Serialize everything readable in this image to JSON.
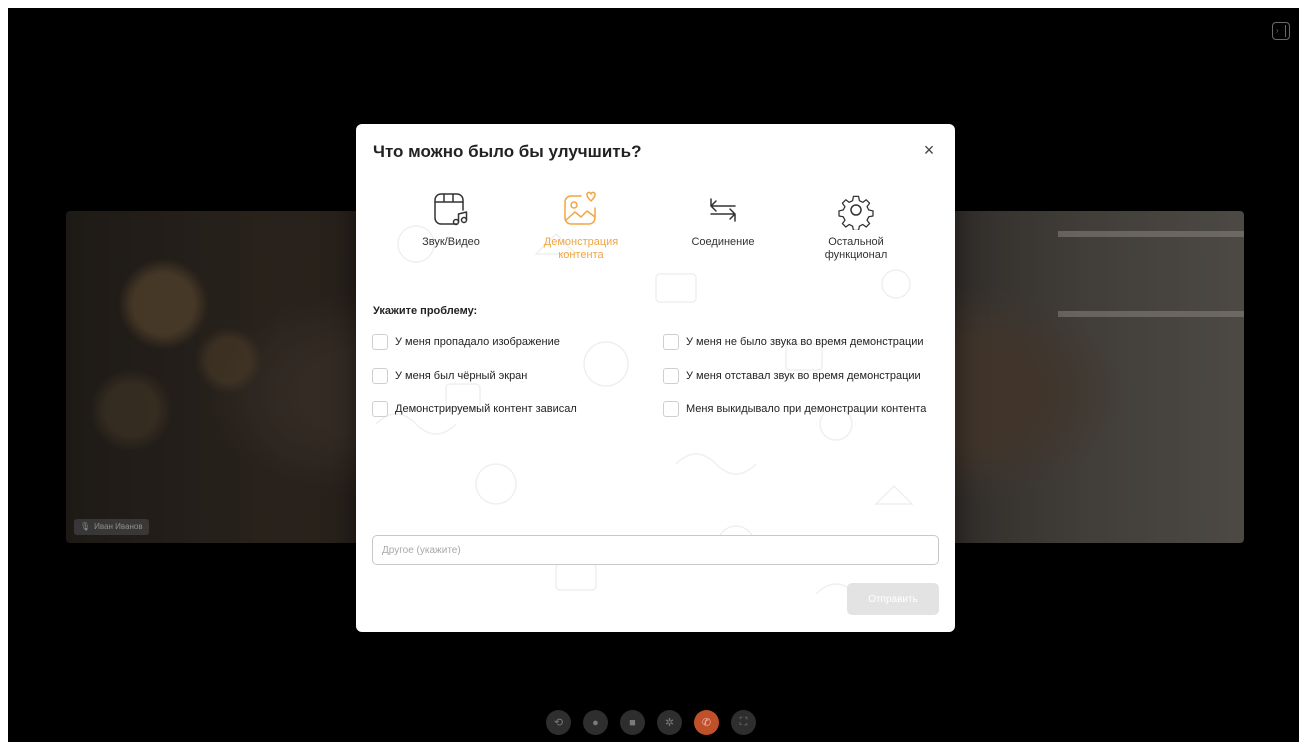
{
  "modal": {
    "title": "Что можно было бы улучшить?",
    "close_symbol": "×",
    "categories": [
      {
        "label": "Звук/Видео",
        "icon": "audio-video-icon",
        "active": false
      },
      {
        "label": "Демонстрация контента",
        "icon": "screen-share-icon",
        "active": true
      },
      {
        "label": "Соединение",
        "icon": "connection-icon",
        "active": false
      },
      {
        "label": "Остальной функционал",
        "icon": "settings-gear-icon",
        "active": false
      }
    ],
    "problem_label": "Укажите проблему:",
    "options": [
      "У меня пропадало изображение",
      "У меня был чёрный экран",
      "Демонстрируемый контент зависал",
      "У меня не было звука во время демонстрации",
      "У меня отставал звук во время демонстрации",
      "Меня выкидывало при демонстрации контента"
    ],
    "other_placeholder": "Другое (укажите)",
    "other_value": "",
    "submit_label": "Отправить"
  },
  "participant": {
    "name": "Иван Иванов"
  },
  "colors": {
    "accent": "#f2a541",
    "submit_disabled": "#e3e3e3",
    "hangup": "#c0502a"
  }
}
